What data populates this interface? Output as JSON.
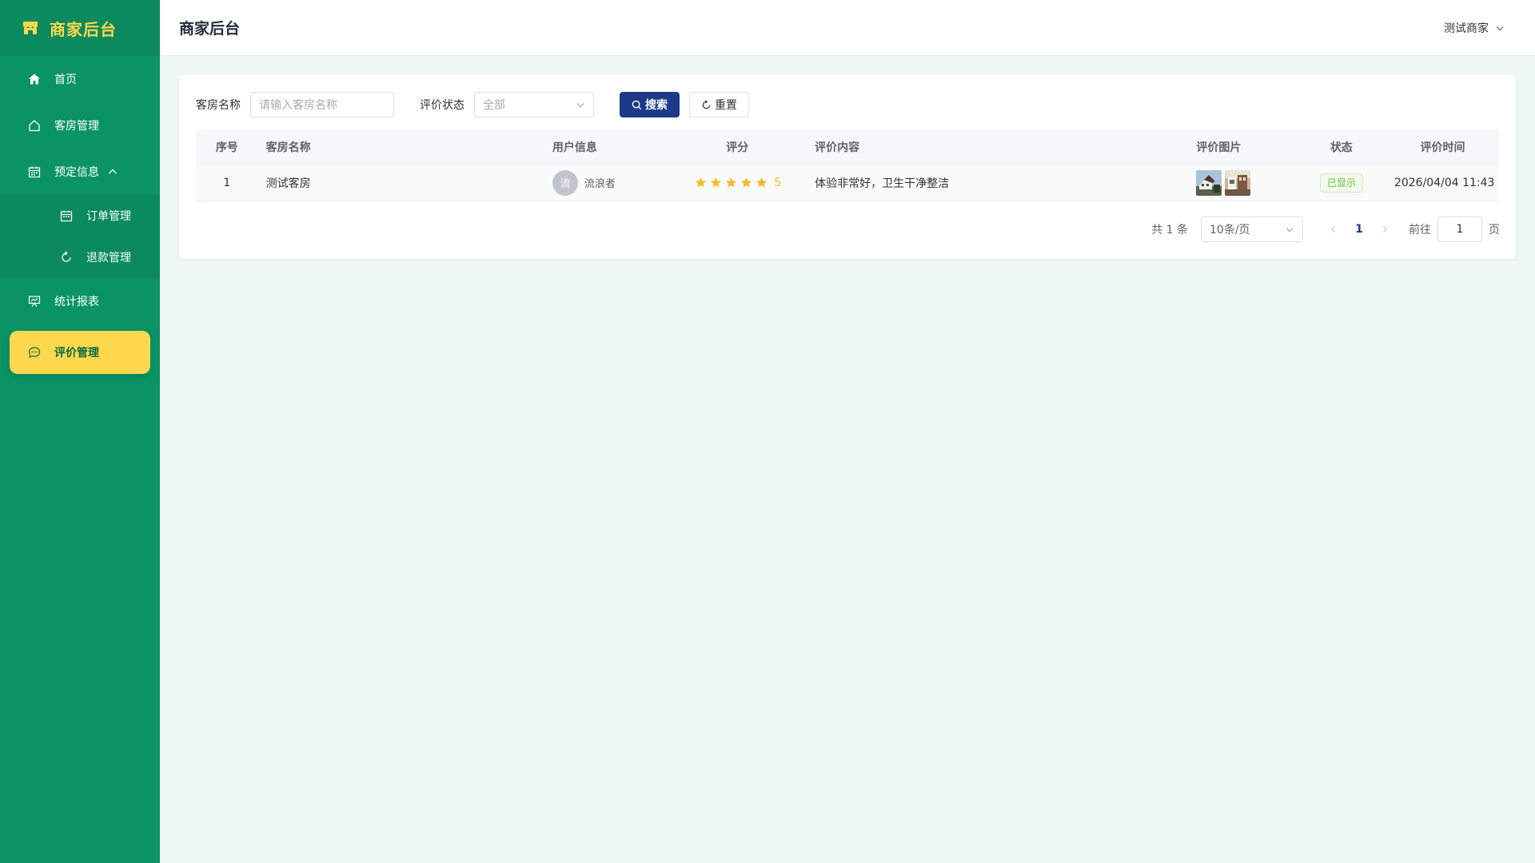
{
  "app": {
    "brand": "商家后台"
  },
  "sidebar": {
    "items": [
      {
        "label": "首页",
        "icon": "home-icon"
      },
      {
        "label": "客房管理",
        "icon": "house-icon"
      },
      {
        "label": "预定信息",
        "icon": "calendar-icon",
        "expanded": true,
        "children": [
          {
            "label": "订单管理",
            "icon": "calendar-icon"
          },
          {
            "label": "退款管理",
            "icon": "refresh-icon"
          }
        ]
      },
      {
        "label": "统计报表",
        "icon": "chart-board-icon"
      },
      {
        "label": "评价管理",
        "icon": "chat-dots-icon",
        "active": true
      }
    ]
  },
  "header": {
    "title": "商家后台",
    "user": "测试商家"
  },
  "filter": {
    "room_label": "客房名称",
    "room_placeholder": "请输入客房名称",
    "status_label": "评价状态",
    "status_value": "全部",
    "search_button": "搜索",
    "reset_button": "重置"
  },
  "table": {
    "columns": [
      "序号",
      "客房名称",
      "用户信息",
      "评分",
      "评价内容",
      "评价图片",
      "状态",
      "评价时间"
    ],
    "rows": [
      {
        "index": "1",
        "room": "测试客房",
        "avatar_text": "流",
        "user": "流浪者",
        "score": "5",
        "content": "体验非常好，卫生干净整洁",
        "status": "已显示",
        "time": "2026/04/04 11:43"
      }
    ]
  },
  "pagination": {
    "total": "共 1 条",
    "page_size": "10条/页",
    "current_page": "1",
    "goto_label": "前往",
    "goto_value": "1",
    "page_suffix": "页"
  },
  "colors": {
    "sidebar_bg": "#0a9466",
    "accent_yellow": "#ffd84d",
    "primary_button": "#1d3a8a",
    "content_bg": "#eef9f1",
    "star": "#f7ba2a",
    "status_green": "#67c23a"
  }
}
